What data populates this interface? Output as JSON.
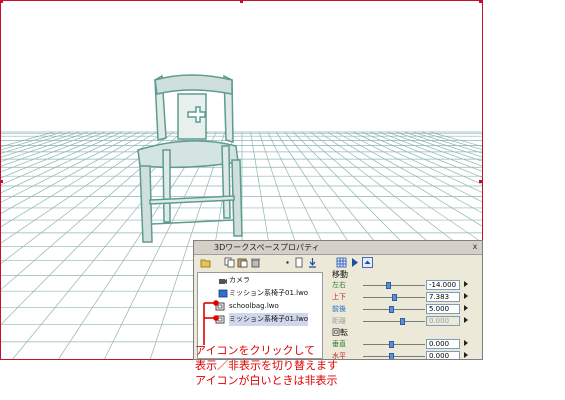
{
  "window": {
    "title": "3Dワークスペースプロパティ",
    "close_glyph": "x"
  },
  "tree": {
    "items": [
      {
        "label": "カメラ",
        "icon": "camera-icon"
      },
      {
        "label": "ミッション系椅子01.lwo",
        "icon": "blue-cube-icon"
      },
      {
        "label": "schoolbag.lwo",
        "icon": "visibility-icon"
      },
      {
        "label": "ミッション系椅子01.lwo",
        "icon": "visibility-icon",
        "selected": true
      }
    ]
  },
  "properties": {
    "move_section": "移動",
    "rotate_section": "回転",
    "move_rows": [
      {
        "label": "左右",
        "value": "-14.000",
        "color": "green",
        "fraction": 0.4
      },
      {
        "label": "上下",
        "value": "7.383",
        "color": "red",
        "fraction": 0.5
      },
      {
        "label": "前後",
        "value": "5.000",
        "color": "blue",
        "fraction": 0.45
      },
      {
        "label": "距離",
        "value": "0.000",
        "color": "disabled",
        "fraction": 0.65
      }
    ],
    "rotate_rows": [
      {
        "label": "垂直",
        "value": "0.000",
        "color": "green",
        "fraction": 0.45
      },
      {
        "label": "水平",
        "value": "0.000",
        "color": "red",
        "fraction": 0.45
      }
    ]
  },
  "annotation": {
    "line1": "アイコンをクリックして",
    "line2": "表示／非表示を切り替えます",
    "line3": "アイコンが白いときは非表示"
  },
  "colors": {
    "accent_red": "#e00000",
    "grid": "#8fb7b0",
    "chair": "#5f9b8f"
  }
}
